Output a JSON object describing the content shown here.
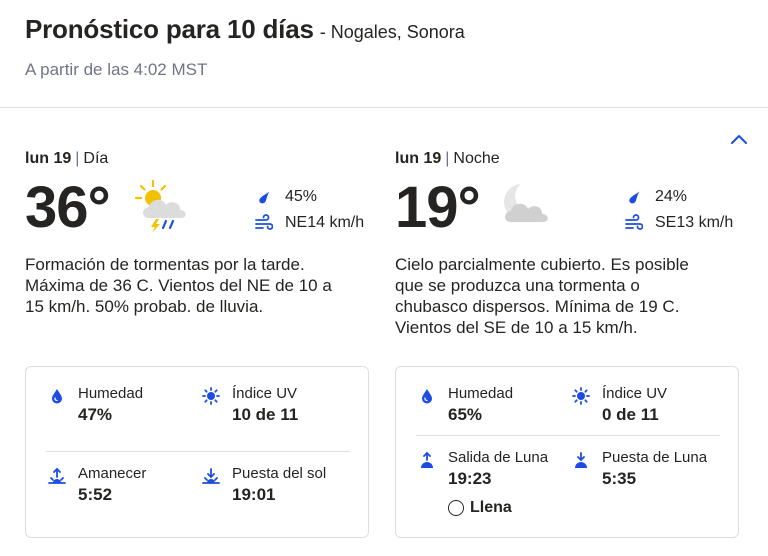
{
  "header": {
    "title": "Pronóstico para 10 días",
    "location": "- Nogales, Sonora",
    "as_of": "A partir de las 4:02 MST"
  },
  "day": {
    "date": "lun 19",
    "sep": "|",
    "part": "Día",
    "temp": "36°",
    "icon": "thunderstorm-sun-icon",
    "precip": "45%",
    "wind": "NE14 km/h",
    "narrative": "Formación de tormentas por la tarde. Máxima de 36 C. Vientos del NE de 10 a 15 km/h. 50% probab. de lluvia.",
    "details": {
      "humidity_label": "Humedad",
      "humidity_value": "47%",
      "uv_label": "Índice UV",
      "uv_value": "10 de 11",
      "sunrise_label": "Amanecer",
      "sunrise_value": "5:52",
      "sunset_label": "Puesta del sol",
      "sunset_value": "19:01"
    }
  },
  "night": {
    "date": "lun 19",
    "sep": "|",
    "part": "Noche",
    "temp": "19°",
    "icon": "partly-cloudy-night-icon",
    "precip": "24%",
    "wind": "SE13 km/h",
    "narrative": "Cielo parcialmente cubierto. Es posible que se produzca una tormenta o chubasco dispersos. Mínima de 19 C. Vientos del SE de 10 a 15 km/h.",
    "details": {
      "humidity_label": "Humedad",
      "humidity_value": "65%",
      "uv_label": "Índice UV",
      "uv_value": "0 de 11",
      "moonrise_label": "Salida de Luna",
      "moonrise_value": "19:23",
      "moonset_label": "Puesta de Luna",
      "moonset_value": "5:35",
      "moon_phase": "Llena"
    }
  },
  "colors": {
    "accent": "#1b4de4",
    "text": "#252422",
    "muted": "#6f7585",
    "divider": "#dedede"
  }
}
